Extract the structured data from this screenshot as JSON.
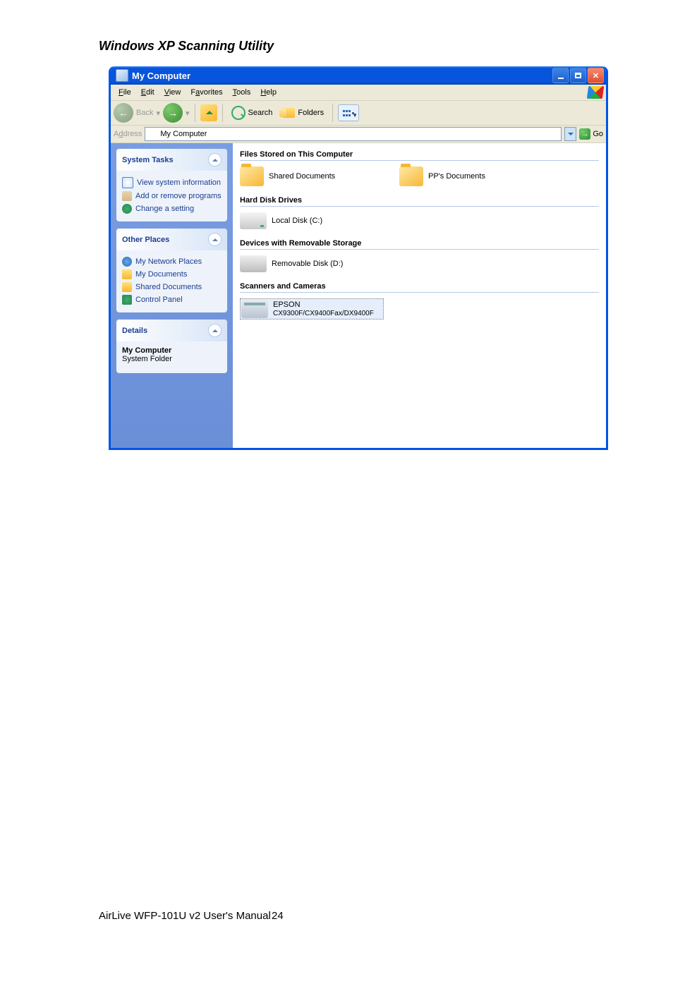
{
  "page": {
    "heading": "Windows XP Scanning Utility",
    "footer_text": "AirLive WFP-101U v2 User's Manual",
    "page_number": "24"
  },
  "window": {
    "title": "My Computer",
    "menu": {
      "file": "File",
      "edit": "Edit",
      "view": "View",
      "favorites": "Favorites",
      "tools": "Tools",
      "help": "Help"
    },
    "toolbar": {
      "back": "Back",
      "search": "Search",
      "folders": "Folders"
    },
    "address": {
      "label": "Address",
      "value": "My Computer",
      "go": "Go"
    }
  },
  "sidebar": {
    "system_tasks": {
      "title": "System Tasks",
      "items": [
        "View system information",
        "Add or remove programs",
        "Change a setting"
      ]
    },
    "other_places": {
      "title": "Other Places",
      "items": [
        "My Network Places",
        "My Documents",
        "Shared Documents",
        "Control Panel"
      ]
    },
    "details": {
      "title": "Details",
      "name": "My Computer",
      "type": "System Folder"
    }
  },
  "content": {
    "groups": [
      {
        "title": "Files Stored on This Computer",
        "items": [
          {
            "label": "Shared Documents",
            "icon": "folder"
          },
          {
            "label": "PP's Documents",
            "icon": "folder"
          }
        ]
      },
      {
        "title": "Hard Disk Drives",
        "items": [
          {
            "label": "Local Disk (C:)",
            "icon": "disk"
          }
        ]
      },
      {
        "title": "Devices with Removable Storage",
        "items": [
          {
            "label": "Removable Disk (D:)",
            "icon": "remov"
          }
        ]
      },
      {
        "title": "Scanners and Cameras",
        "items": [
          {
            "label_line1": "EPSON",
            "label_line2": "CX9300F/CX9400Fax/DX9400F",
            "icon": "scan",
            "selected": true
          }
        ]
      }
    ]
  }
}
